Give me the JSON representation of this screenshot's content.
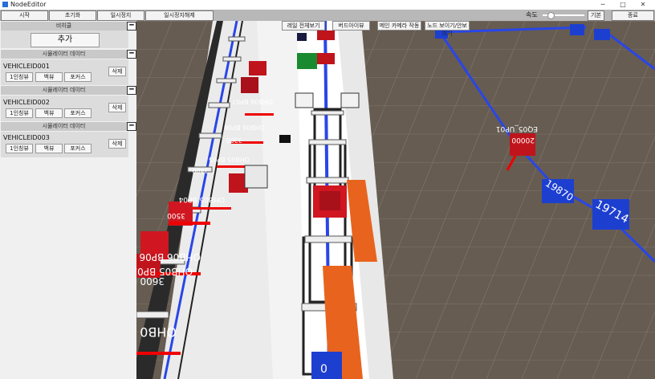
{
  "window": {
    "title": "NodeEditor",
    "minimize": "─",
    "maximize": "□",
    "close": "✕"
  },
  "menu": {
    "start": "시작",
    "reset": "초기화",
    "pause": "일시정지",
    "unpause": "일시정지해제",
    "speed_label": "속도",
    "default": "기본",
    "exit": "종료"
  },
  "speed": {
    "value_fraction": 0.2
  },
  "left_panel": {
    "vehicle_section_title": "비히클",
    "add_label": "추가",
    "collapse_glyph": "━",
    "vehicles": [
      {
        "header": "시뮬레이터 데이터",
        "id": "VEHICLEID001",
        "view1": "1인칭뷰",
        "back": "백뷰",
        "focus": "포커스",
        "delete": "삭제"
      },
      {
        "header": "시뮬레이터 데이터",
        "id": "VEHICLEID002",
        "view1": "1인칭뷰",
        "back": "백뷰",
        "focus": "포커스",
        "delete": "삭제"
      },
      {
        "header": "시뮬레이터 데이터",
        "id": "VEHICLEID003",
        "view1": "1인칭뷰",
        "back": "백뷰",
        "focus": "포커스",
        "delete": "삭제"
      }
    ]
  },
  "viewport": {
    "buttons": {
      "rail_overview": "레일 전체보기",
      "birds_eye": "버드아이뷰",
      "main_camera": "메인 카메라 작동",
      "node_toggle": "노드 보이기/안보이기"
    },
    "labels": {
      "ohb07": "OHB06 BP07",
      "ohb06": "OHB06 BP06",
      "n3300": "3300",
      "ohb05": "OHB05 BP05",
      "n3400": "3400",
      "ohb04a": "OHB05 BP04",
      "n3500": "3500",
      "ohb06b": "OHB06 BP06",
      "ohb05b": "OHB05 BP05",
      "n3600": "3600",
      "ohb0": "OHB0",
      "eq_port": "EQ05_UP01",
      "n20000": "20000",
      "n19870": "19870",
      "n19714": "19714",
      "n0": "0"
    },
    "colors": {
      "rail": "#2946e8",
      "node_blue": "#1d3fd0",
      "node_red": "#c0141c",
      "orange": "#e8641e",
      "floor": "#6a5f55"
    }
  }
}
